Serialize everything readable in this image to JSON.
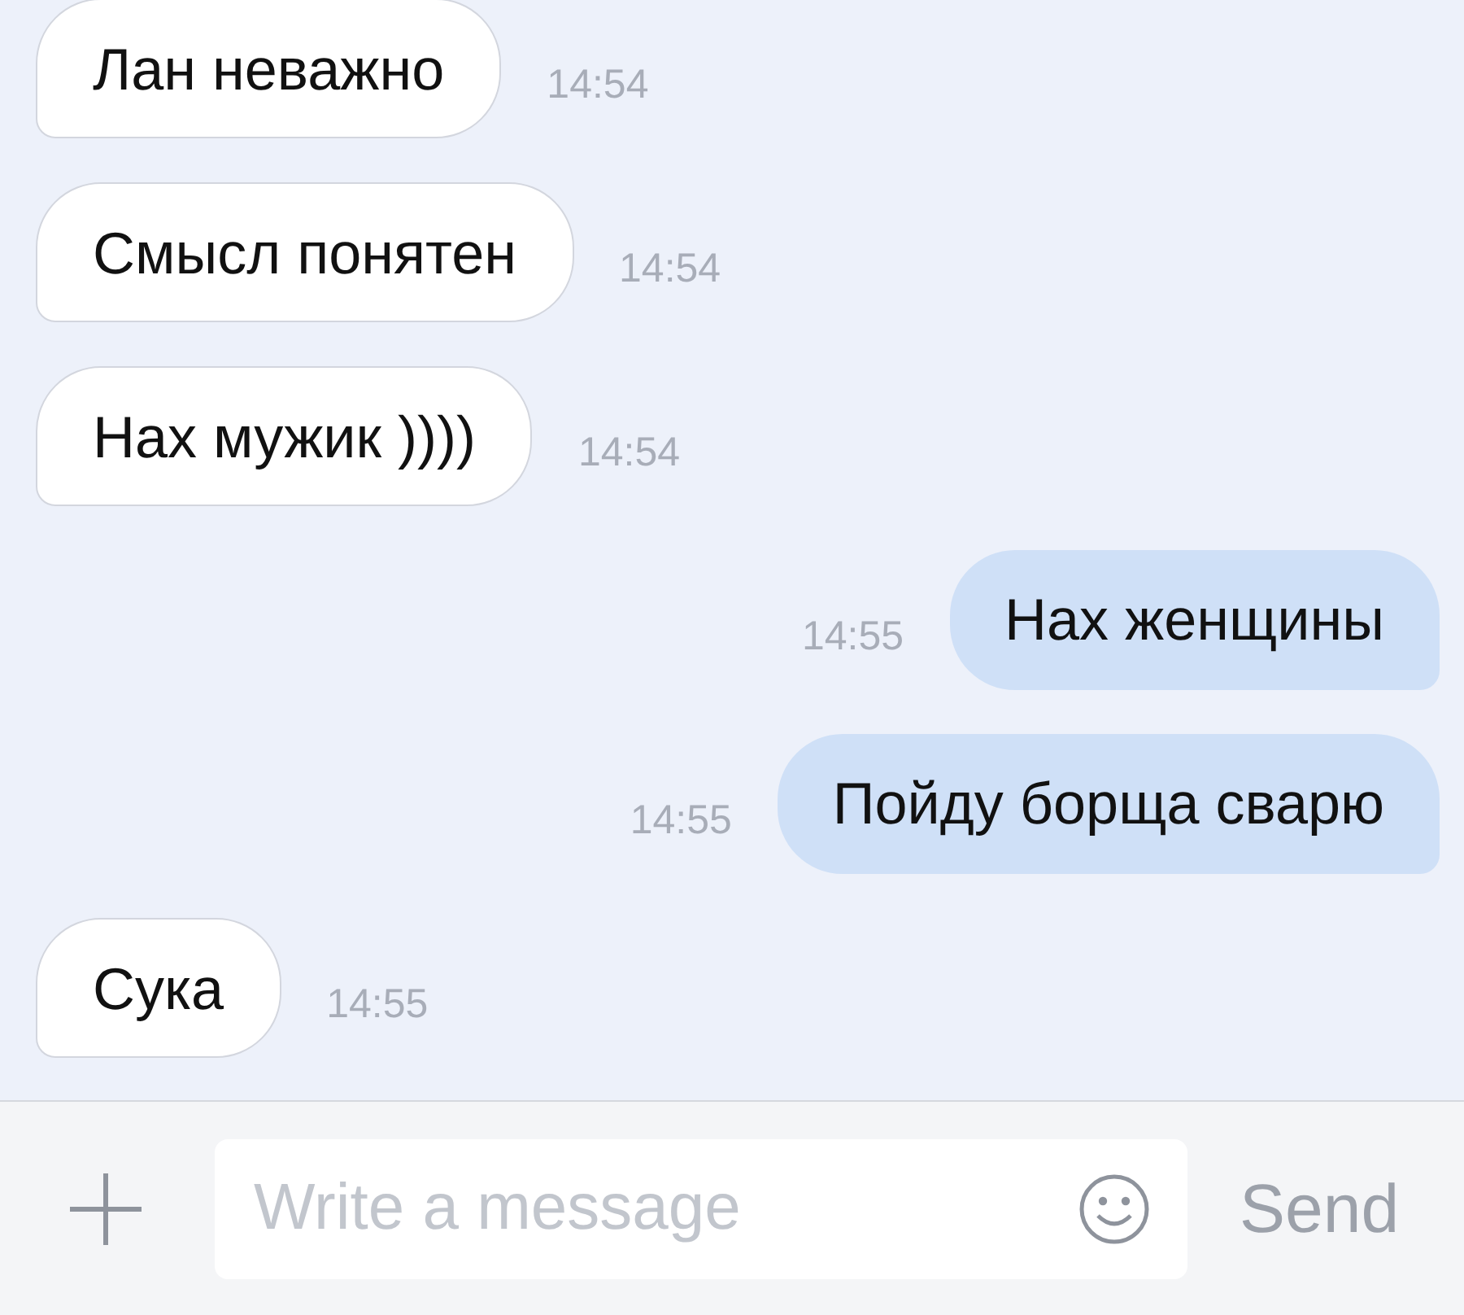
{
  "messages": [
    {
      "text": "Лан неважно",
      "time": "14:54",
      "kind": "incoming"
    },
    {
      "text": "Смысл понятен",
      "time": "14:54",
      "kind": "incoming"
    },
    {
      "text": "Нах мужик ))))",
      "time": "14:54",
      "kind": "incoming"
    },
    {
      "text": "Нах женщины",
      "time": "14:55",
      "kind": "outgoing"
    },
    {
      "text": "Пойду борща сварю",
      "time": "14:55",
      "kind": "outgoing"
    },
    {
      "text": "Сука",
      "time": "14:55",
      "kind": "incoming"
    }
  ],
  "composer": {
    "placeholder": "Write a message",
    "send": "Send"
  }
}
